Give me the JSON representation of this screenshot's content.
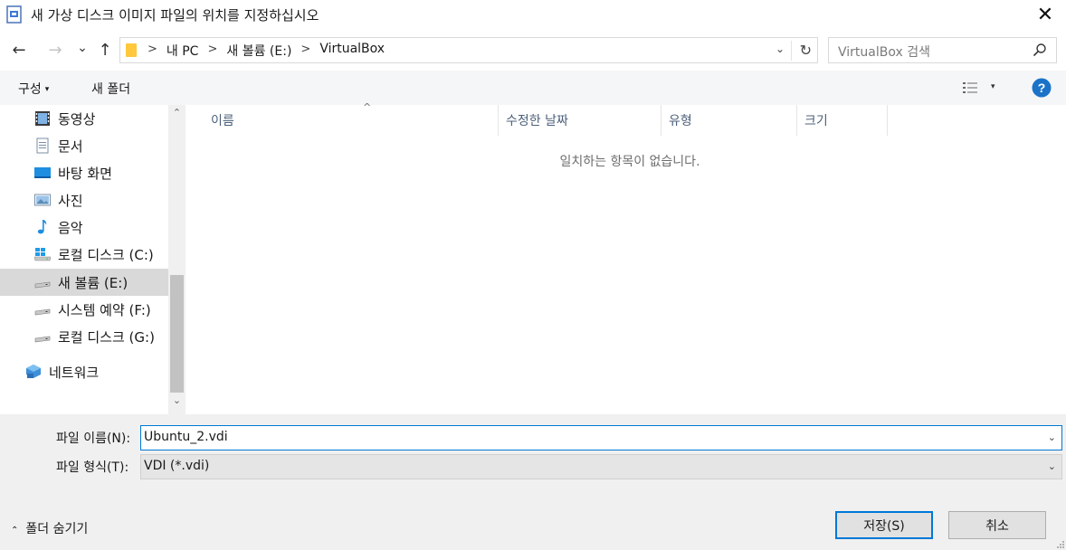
{
  "window": {
    "title": "새 가상 디스크 이미지 파일의 위치를 지정하십시오",
    "close_glyph": "✕"
  },
  "nav": {
    "back_glyph": "←",
    "forward_glyph": "→",
    "recent_glyph": "⌄",
    "up_glyph": "↑"
  },
  "address": {
    "crumbs": [
      "내 PC",
      "새 볼륨 (E:)",
      "VirtualBox"
    ],
    "separator": ">",
    "dropdown_glyph": "⌄",
    "refresh_glyph": "↻"
  },
  "search": {
    "placeholder": "VirtualBox 검색",
    "icon": "search-icon"
  },
  "commands": {
    "organize": "구성",
    "organize_caret": "▾",
    "new_folder": "새 폴더",
    "view_caret": "▾",
    "help_label": "?"
  },
  "sidebar": {
    "items": [
      {
        "label": "동영상",
        "icon": "video-icon"
      },
      {
        "label": "문서",
        "icon": "document-icon"
      },
      {
        "label": "바탕 화면",
        "icon": "desktop-icon"
      },
      {
        "label": "사진",
        "icon": "pictures-icon"
      },
      {
        "label": "음악",
        "icon": "music-icon"
      },
      {
        "label": "로컬 디스크 (C:)",
        "icon": "windows-drive-icon"
      },
      {
        "label": "새 볼륨 (E:)",
        "icon": "drive-icon",
        "selected": true
      },
      {
        "label": "시스템 예약 (F:)",
        "icon": "drive-icon"
      },
      {
        "label": "로컬 디스크 (G:)",
        "icon": "drive-icon"
      },
      {
        "label": "네트워크",
        "icon": "network-icon"
      }
    ],
    "scroll_up_glyph": "⌃",
    "scroll_down_glyph": "⌄"
  },
  "columns": {
    "name": "이름",
    "modified": "수정한 날짜",
    "type": "유형",
    "size": "크기",
    "sort_glyph": "^"
  },
  "empty_message": "일치하는 항목이 없습니다.",
  "form": {
    "filename_label": "파일 이름(N):",
    "filename_value": "Ubuntu_2.vdi",
    "filetype_label": "파일 형식(T):",
    "filetype_value": "VDI (*.vdi)",
    "dropdown_glyph": "⌄"
  },
  "footer": {
    "hide_folders": "폴더 숨기기",
    "hide_chevron": "⌃",
    "save": "저장(S)",
    "cancel": "취소"
  },
  "colors": {
    "accent": "#0078d7",
    "selected_bg": "#d9d9d9",
    "bottom_bg": "#f0f0f0",
    "header_text": "#4c607a"
  }
}
